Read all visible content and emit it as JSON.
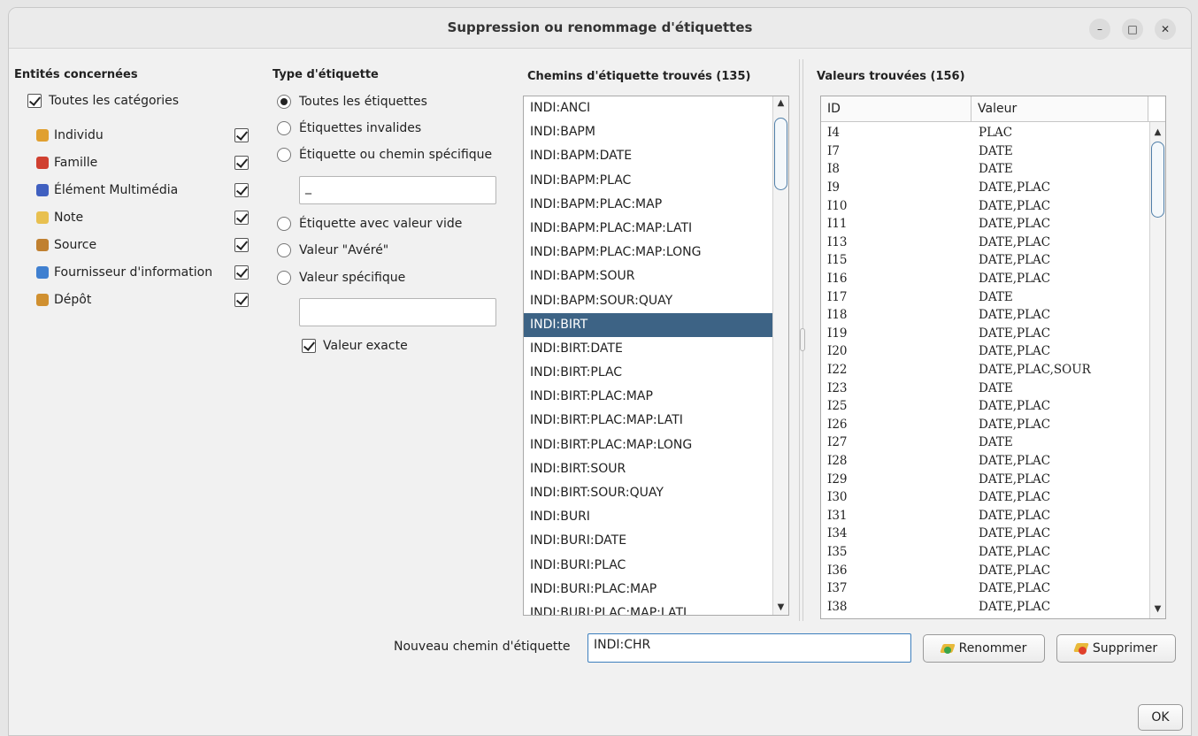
{
  "window": {
    "title": "Suppression ou renommage d'étiquettes",
    "controls": {
      "minimize": "–",
      "maximize": "□",
      "close": "✕"
    }
  },
  "entities": {
    "heading": "Entités concernées",
    "all_label": "Toutes les catégories",
    "all_checked": true,
    "items": [
      {
        "label": "Individu",
        "icon": "individual-icon",
        "checked": true,
        "color": "#e0a030"
      },
      {
        "label": "Famille",
        "icon": "family-icon",
        "checked": true,
        "color": "#d04030"
      },
      {
        "label": "Élément Multimédia",
        "icon": "multimedia-icon",
        "checked": true,
        "color": "#4060c0"
      },
      {
        "label": "Note",
        "icon": "note-icon",
        "checked": true,
        "color": "#e8c050"
      },
      {
        "label": "Source",
        "icon": "source-icon",
        "checked": true,
        "color": "#c08030"
      },
      {
        "label": "Fournisseur d'information",
        "icon": "submitter-icon",
        "checked": true,
        "color": "#4080d0"
      },
      {
        "label": "Dépôt",
        "icon": "repository-icon",
        "checked": true,
        "color": "#d09030"
      }
    ]
  },
  "tag_type": {
    "heading": "Type d'étiquette",
    "opt_all": "Toutes les étiquettes",
    "opt_invalid": "Étiquettes invalides",
    "opt_specific": "Étiquette ou chemin spécifique",
    "specific_value": "_",
    "opt_empty": "Étiquette avec valeur vide",
    "opt_proven": "Valeur \"Avéré\"",
    "opt_specific_value": "Valeur spécifique",
    "specific_value_input": "",
    "exact_label": "Valeur exacte",
    "exact_checked": true,
    "selected": "opt_all"
  },
  "paths": {
    "heading": "Chemins d'étiquette trouvés (135)",
    "selected_index": 9,
    "items": [
      "INDI:ANCI",
      "INDI:BAPM",
      "INDI:BAPM:DATE",
      "INDI:BAPM:PLAC",
      "INDI:BAPM:PLAC:MAP",
      "INDI:BAPM:PLAC:MAP:LATI",
      "INDI:BAPM:PLAC:MAP:LONG",
      "INDI:BAPM:SOUR",
      "INDI:BAPM:SOUR:QUAY",
      "INDI:BIRT",
      "INDI:BIRT:DATE",
      "INDI:BIRT:PLAC",
      "INDI:BIRT:PLAC:MAP",
      "INDI:BIRT:PLAC:MAP:LATI",
      "INDI:BIRT:PLAC:MAP:LONG",
      "INDI:BIRT:SOUR",
      "INDI:BIRT:SOUR:QUAY",
      "INDI:BURI",
      "INDI:BURI:DATE",
      "INDI:BURI:PLAC",
      "INDI:BURI:PLAC:MAP",
      "INDI:BURI:PLAC:MAP:LATI"
    ]
  },
  "values": {
    "heading": "Valeurs trouvées (156)",
    "col_id": "ID",
    "col_value": "Valeur",
    "rows": [
      [
        "I4",
        "PLAC"
      ],
      [
        "I7",
        "DATE"
      ],
      [
        "I8",
        "DATE"
      ],
      [
        "I9",
        "DATE,PLAC"
      ],
      [
        "I10",
        "DATE,PLAC"
      ],
      [
        "I11",
        "DATE,PLAC"
      ],
      [
        "I13",
        "DATE,PLAC"
      ],
      [
        "I15",
        "DATE,PLAC"
      ],
      [
        "I16",
        "DATE,PLAC"
      ],
      [
        "I17",
        "DATE"
      ],
      [
        "I18",
        "DATE,PLAC"
      ],
      [
        "I19",
        "DATE,PLAC"
      ],
      [
        "I20",
        "DATE,PLAC"
      ],
      [
        "I22",
        "DATE,PLAC,SOUR"
      ],
      [
        "I23",
        "DATE"
      ],
      [
        "I25",
        "DATE,PLAC"
      ],
      [
        "I26",
        "DATE,PLAC"
      ],
      [
        "I27",
        "DATE"
      ],
      [
        "I28",
        "DATE,PLAC"
      ],
      [
        "I29",
        "DATE,PLAC"
      ],
      [
        "I30",
        "DATE,PLAC"
      ],
      [
        "I31",
        "DATE,PLAC"
      ],
      [
        "I34",
        "DATE,PLAC"
      ],
      [
        "I35",
        "DATE,PLAC"
      ],
      [
        "I36",
        "DATE,PLAC"
      ],
      [
        "I37",
        "DATE,PLAC"
      ],
      [
        "I38",
        "DATE,PLAC"
      ]
    ]
  },
  "footer": {
    "new_path_label": "Nouveau chemin d'étiquette",
    "new_path_value": "INDI:CHR",
    "rename_label": "Renommer",
    "delete_label": "Supprimer",
    "ok_label": "OK"
  },
  "colors": {
    "selection": "#3d6385",
    "scroll_thumb": "#4f7ea8"
  }
}
